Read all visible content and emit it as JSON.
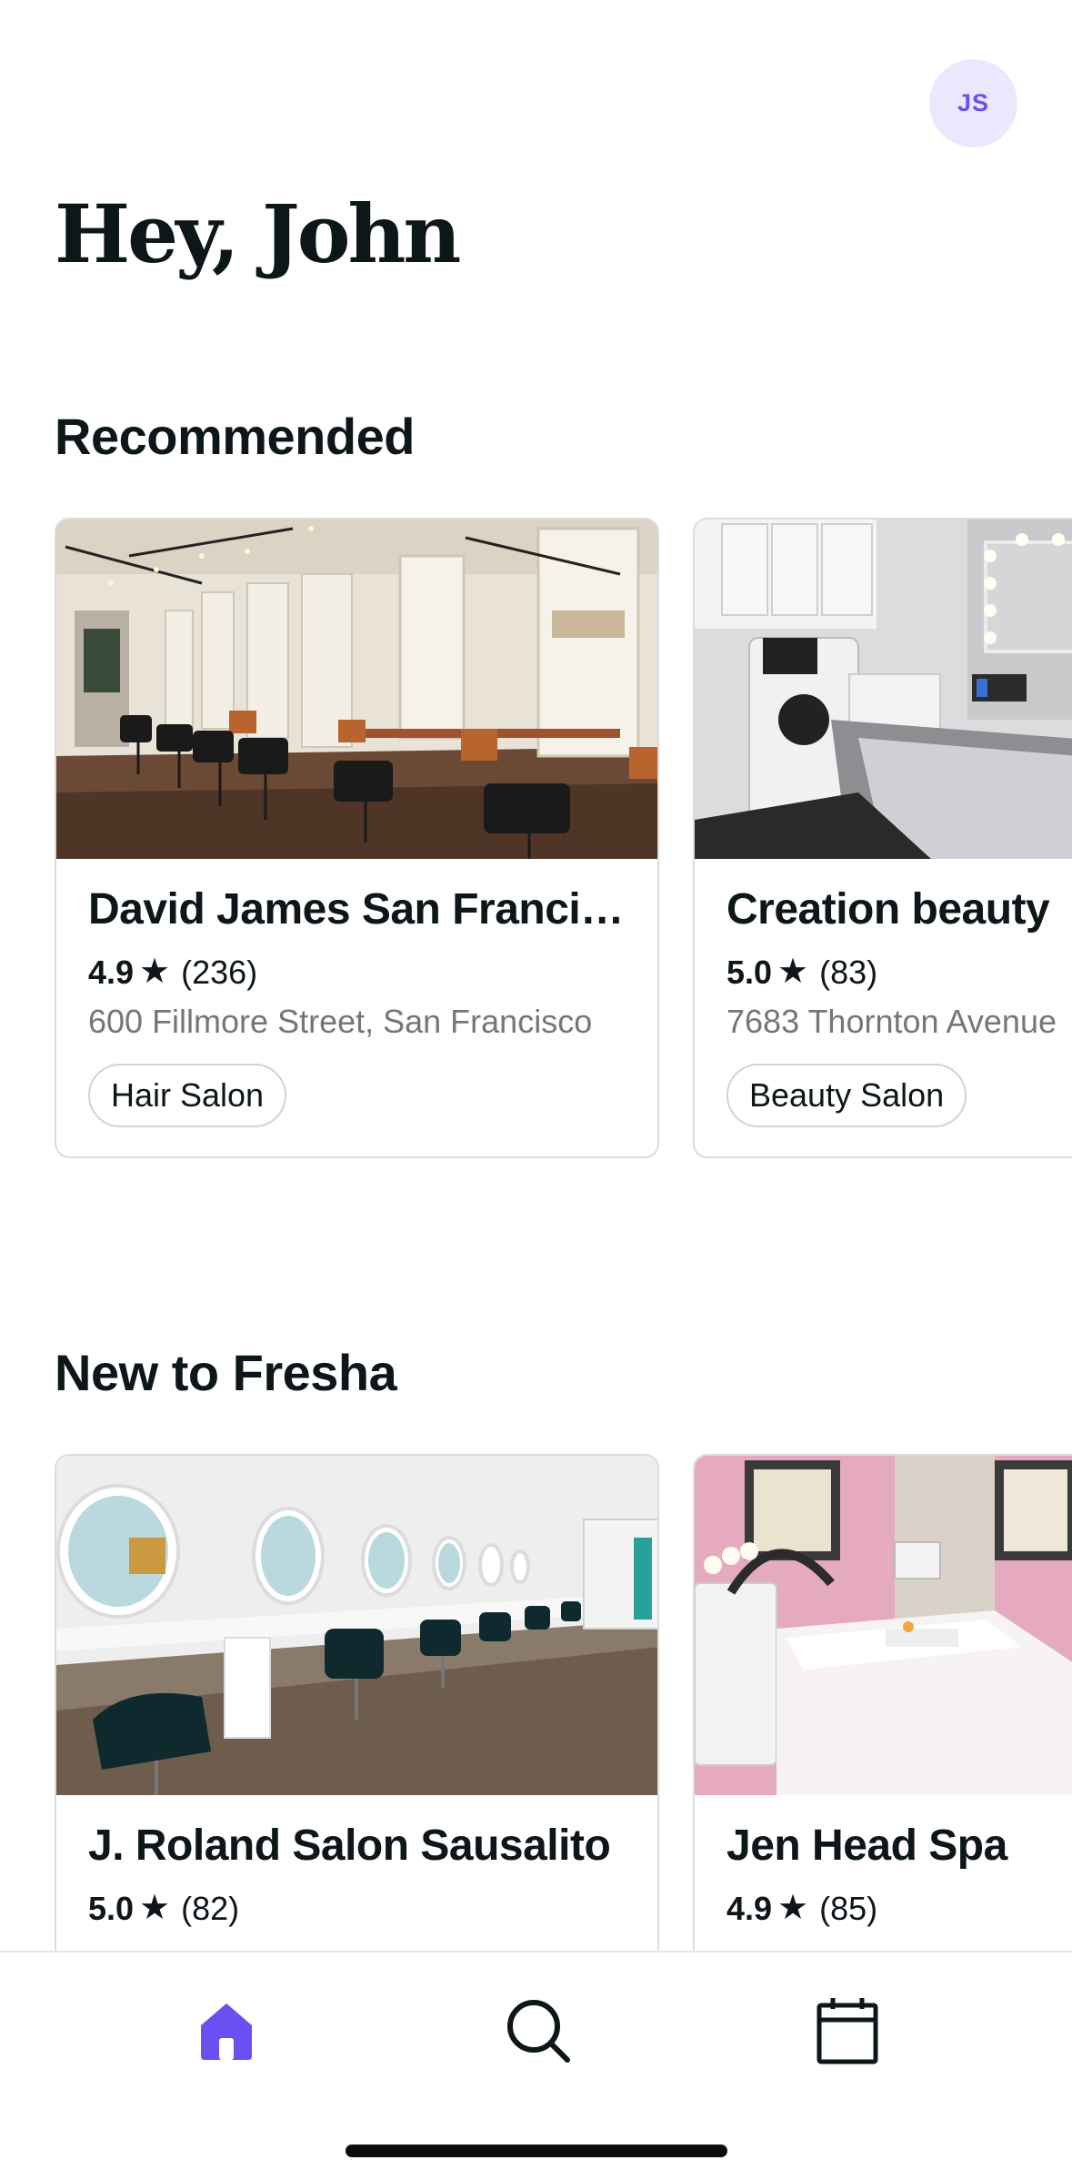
{
  "header": {
    "avatar_initials": "JS",
    "greeting": "Hey, John"
  },
  "sections": {
    "recommended": {
      "title": "Recommended",
      "cards": [
        {
          "name": "David James San Francisco",
          "rating": "4.9",
          "reviews": "(236)",
          "address": "600 Fillmore Street, San Francisco",
          "category": "Hair Salon"
        },
        {
          "name": "Creation beauty",
          "rating": "5.0",
          "reviews": "(83)",
          "address": "7683 Thornton Avenue",
          "category": "Beauty Salon"
        }
      ]
    },
    "new_to_fresha": {
      "title": "New to Fresha",
      "cards": [
        {
          "name": "J. Roland Salon Sausalito",
          "rating": "5.0",
          "reviews": "(82)"
        },
        {
          "name": "Jen Head Spa",
          "rating": "4.9",
          "reviews": "(85)"
        }
      ]
    }
  },
  "tabbar": {
    "items": [
      {
        "icon": "home-icon",
        "active": true
      },
      {
        "icon": "search-icon",
        "active": false
      },
      {
        "icon": "calendar-icon",
        "active": false
      }
    ],
    "active_color": "#6950f3"
  },
  "colors": {
    "accent": "#6950f3",
    "avatar_bg": "#ebe8fe",
    "text_primary": "#0d1619",
    "text_secondary": "#757676"
  }
}
